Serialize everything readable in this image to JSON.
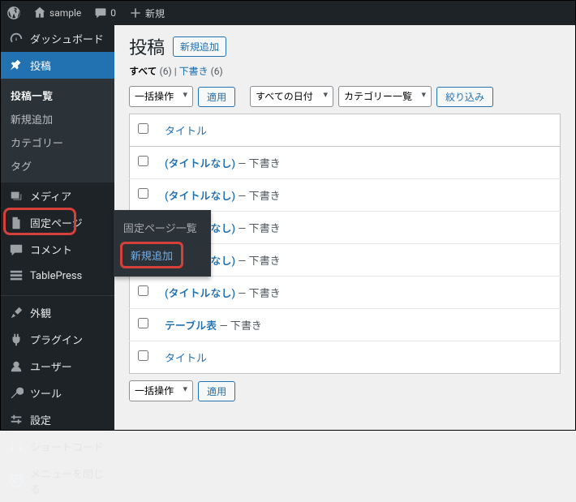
{
  "adminbar": {
    "site": "sample",
    "comments": "0",
    "new": "新規"
  },
  "sidebar": {
    "dashboard": "ダッシュボード",
    "posts": "投稿",
    "posts_sub": {
      "list": "投稿一覧",
      "add": "新規追加",
      "cat": "カテゴリー",
      "tag": "タグ"
    },
    "media": "メディア",
    "pages": "固定ページ",
    "comments": "コメント",
    "tablepress": "TablePress",
    "appearance": "外観",
    "plugins": "プラグイン",
    "users": "ユーザー",
    "tools": "ツール",
    "settings": "設定",
    "shortcode": "ショートコード",
    "collapse": "メニューを閉じる"
  },
  "flyout": {
    "head": "固定ページ一覧",
    "add": "新規追加"
  },
  "page": {
    "title": "投稿",
    "addnew": "新規追加",
    "views": {
      "all": "すべて",
      "all_cnt": "(6)",
      "sep": " | ",
      "draft": "下書き",
      "draft_cnt": "(6)"
    },
    "filters": {
      "bulk": "一括操作",
      "apply": "適用",
      "dates": "すべての日付",
      "cats": "カテゴリー一覧",
      "filter": "絞り込み"
    },
    "cols": {
      "title": "タイトル"
    },
    "rows": [
      {
        "title": "(タイトルなし)",
        "state": " — 下書き"
      },
      {
        "title": "(タイトルなし)",
        "state": " — 下書き"
      },
      {
        "title": "(タイトルなし)",
        "state": " — 下書き"
      },
      {
        "title": "(タイトルなし)",
        "state": " — 下書き"
      },
      {
        "title": "(タイトルなし)",
        "state": " — 下書き"
      },
      {
        "title": "テーブル表",
        "state": " — 下書き"
      }
    ]
  }
}
